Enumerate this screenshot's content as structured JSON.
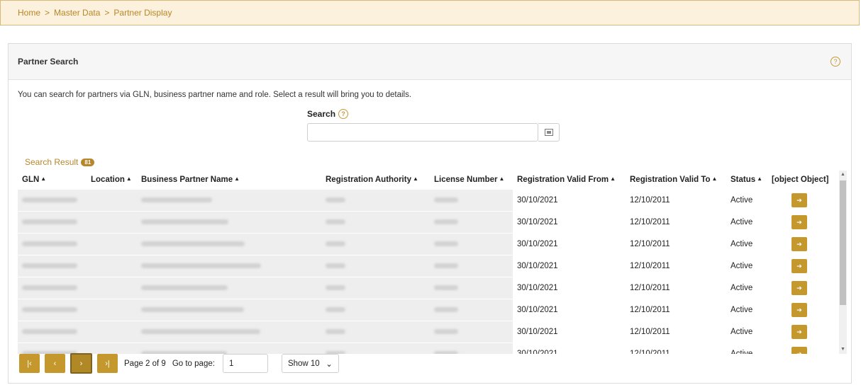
{
  "breadcrumb": {
    "items": [
      "Home",
      "Master Data",
      "Partner Display"
    ],
    "sep": ">"
  },
  "panel": {
    "title": "Partner Search",
    "help": "?"
  },
  "description": "You can search for partners via GLN, business partner name and role. Select a result will bring you to details.",
  "search": {
    "label": "Search",
    "value": "",
    "placeholder": ""
  },
  "result": {
    "label": "Search Result",
    "count": "81"
  },
  "columns": [
    "GLN",
    "Location",
    "Business Partner Name",
    "Registration Authority",
    "License Number",
    "Registration Valid From",
    "Registration Valid To",
    "Status",
    "[object Object]"
  ],
  "rows": [
    {
      "valid_from": "30/10/2021",
      "valid_to": "12/10/2011",
      "status": "Active"
    },
    {
      "valid_from": "30/10/2021",
      "valid_to": "12/10/2011",
      "status": "Active"
    },
    {
      "valid_from": "30/10/2021",
      "valid_to": "12/10/2011",
      "status": "Active"
    },
    {
      "valid_from": "30/10/2021",
      "valid_to": "12/10/2011",
      "status": "Active"
    },
    {
      "valid_from": "30/10/2021",
      "valid_to": "12/10/2011",
      "status": "Active"
    },
    {
      "valid_from": "30/10/2021",
      "valid_to": "12/10/2011",
      "status": "Active"
    },
    {
      "valid_from": "30/10/2021",
      "valid_to": "12/10/2011",
      "status": "Active"
    },
    {
      "valid_from": "30/10/2021",
      "valid_to": "12/10/2011",
      "status": "Active"
    }
  ],
  "pager": {
    "first": "|‹",
    "prev": "‹",
    "next": "›",
    "last": "›|",
    "page_text": "Page 2 of 9",
    "goto_label": "Go to page:",
    "goto_value": "1",
    "show": "Show 10"
  },
  "colors": {
    "accent": "#c4982c",
    "breadcrumb_bg": "#fbf1dc"
  }
}
